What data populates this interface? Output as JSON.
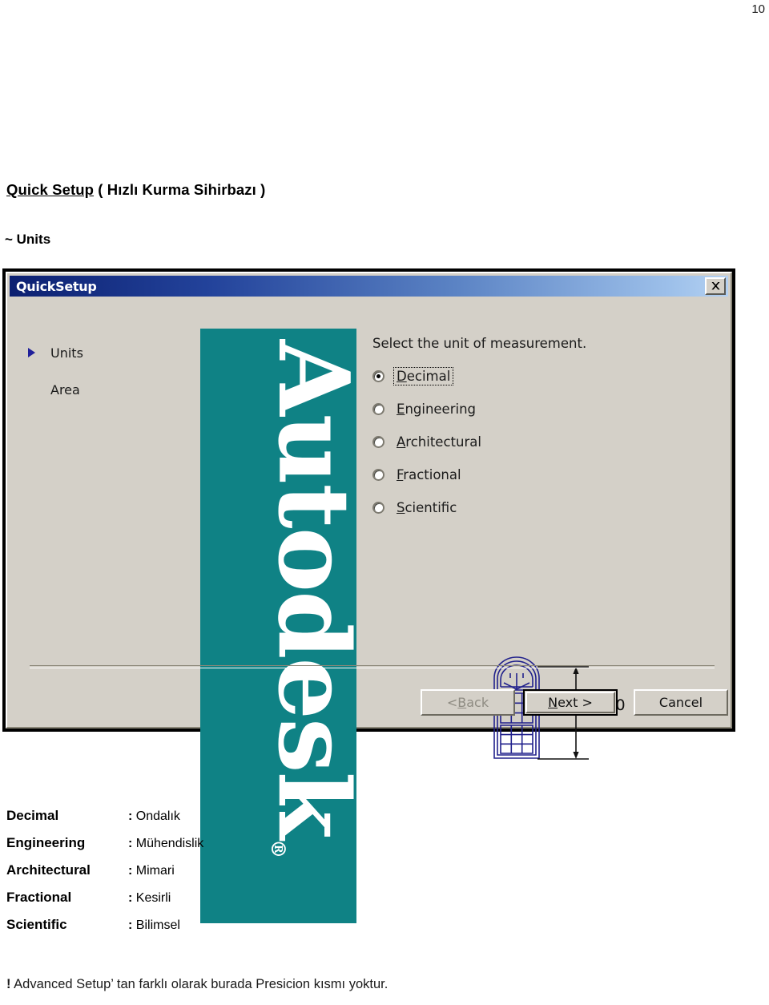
{
  "page": {
    "number": "10"
  },
  "heading": {
    "underlined": "Quick Setup",
    "rest": " ( Hızlı Kurma Sihirbazı )",
    "subheading": "~ Units"
  },
  "dialog": {
    "title": "QuickSetup",
    "close_icon": "close-icon",
    "sidebar": [
      {
        "label": "Units",
        "active": true
      },
      {
        "label": "Area",
        "active": false
      }
    ],
    "brand": {
      "name": "Autodesk",
      "trademark": "®",
      "panel_color": "#0f8285"
    },
    "prompt": "Select the unit of measurement.",
    "options": [
      {
        "label": "Decimal",
        "accel": "D",
        "selected": true,
        "focused": true
      },
      {
        "label": "Engineering",
        "accel": "E",
        "selected": false,
        "focused": false
      },
      {
        "label": "Architectural",
        "accel": "A",
        "selected": false,
        "focused": false
      },
      {
        "label": "Fractional",
        "accel": "F",
        "selected": false,
        "focused": false
      },
      {
        "label": "Scientific",
        "accel": "S",
        "selected": false,
        "focused": false
      }
    ],
    "illustration": {
      "name": "window-sample-drawing",
      "dimension_value": "15.5000",
      "line_color": "#21218c"
    },
    "buttons": [
      {
        "pre": "< ",
        "accel": "B",
        "post": "ack",
        "disabled": true,
        "default": false,
        "name": "back-button"
      },
      {
        "pre": "",
        "accel": "N",
        "post": "ext >",
        "disabled": false,
        "default": true,
        "name": "next-button"
      },
      {
        "pre": "",
        "accel": "",
        "post": "Cancel",
        "disabled": false,
        "default": false,
        "name": "cancel-button"
      }
    ],
    "titlebar_gradient_from": "#0c2071",
    "titlebar_gradient_to": "#b4d1f2",
    "face_color": "#d4d0c8"
  },
  "glossary": {
    "rows": [
      {
        "term": "Decimal",
        "colon": ":",
        "definition": "Ondalık"
      },
      {
        "term": "Engineering",
        "colon": ":",
        "definition": "Mühendislik"
      },
      {
        "term": "Architectural",
        "colon": ":",
        "definition": "Mimari"
      },
      {
        "term": "Fractional",
        "colon": ":",
        "definition": "Kesirli"
      },
      {
        "term": "Scientific",
        "colon": ":",
        "definition": "Bilimsel"
      }
    ]
  },
  "footer": {
    "bang": "!",
    "text": " Advanced Setup’ tan farklı olarak burada Presicion kısmı yoktur."
  }
}
